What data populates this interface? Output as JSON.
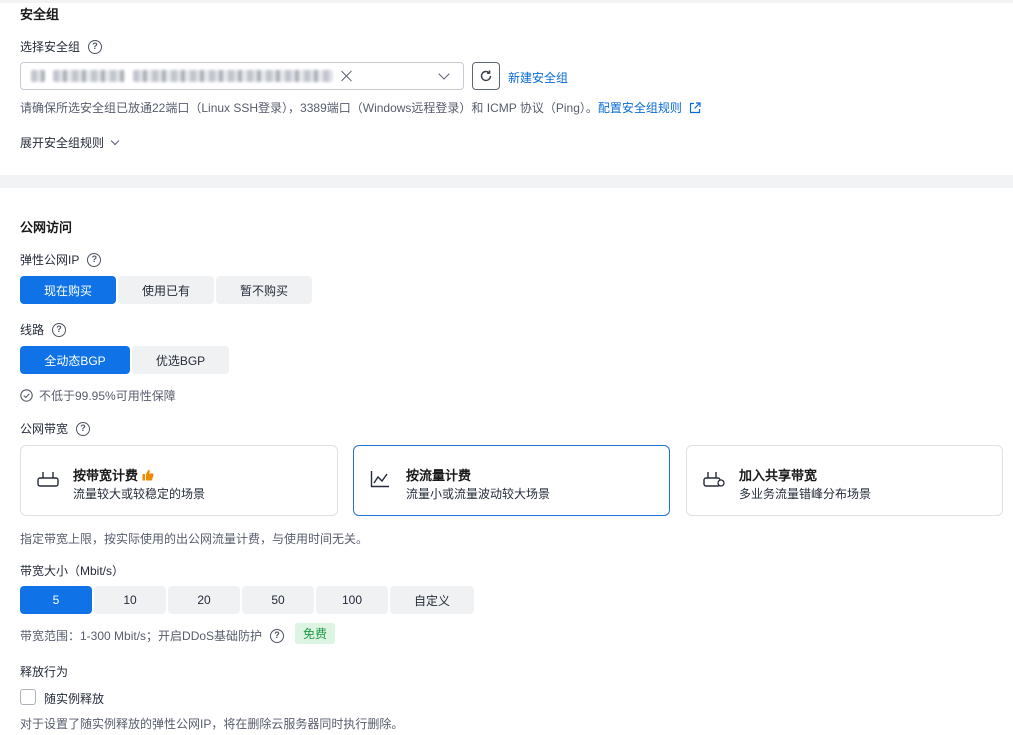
{
  "security_group": {
    "section_title": "安全组",
    "select_label": "选择安全组",
    "new_group_link": "新建安全组",
    "port_hint": "请确保所选安全组已放通22端口（Linux SSH登录），3389端口（Windows远程登录）和 ICMP 协议（Ping）。",
    "config_rules_link": "配置安全组规则",
    "expand_rules": "展开安全组规则"
  },
  "public_access": {
    "section_title": "公网访问",
    "eip_label": "弹性公网IP",
    "eip_options": [
      "现在购买",
      "使用已有",
      "暂不购买"
    ],
    "eip_selected": "现在购买",
    "line_label": "线路",
    "line_options": [
      "全动态BGP",
      "优选BGP"
    ],
    "line_selected": "全动态BGP",
    "availability_note": "不低于99.95%可用性保障",
    "bandwidth_label": "公网带宽",
    "billing_cards": [
      {
        "title": "按带宽计费",
        "desc": "流量较大或较稳定的场景",
        "icon": "router-icon",
        "recommended": true
      },
      {
        "title": "按流量计费",
        "desc": "流量小或流量波动较大场景",
        "icon": "line-chart-icon",
        "selected": true
      },
      {
        "title": "加入共享带宽",
        "desc": "多业务流量错峰分布场景",
        "icon": "shared-router-icon"
      }
    ],
    "billing_hint": "指定带宽上限，按实际使用的出公网流量计费，与使用时间无关。",
    "bandwidth_size_label": "带宽大小（Mbit/s）",
    "bandwidth_options": [
      "5",
      "10",
      "20",
      "50",
      "100",
      "自定义"
    ],
    "bandwidth_selected": "5",
    "bandwidth_range": "带宽范围：1-300 Mbit/s；开启DDoS基础防护",
    "free_badge": "免费",
    "release_label": "释放行为",
    "release_checkbox": "随实例释放",
    "release_checked": false,
    "release_hint": "对于设置了随实例释放的弹性公网IP，将在删除云服务器同时执行删除。"
  },
  "colors": {
    "primary": "#0f72e6",
    "link": "#0a6bd6",
    "card_selected_border": "#2371d6",
    "free_badge_bg": "#ddf4e3",
    "free_badge_text": "#1f9a46",
    "thumb_icon": "#f08a00"
  }
}
